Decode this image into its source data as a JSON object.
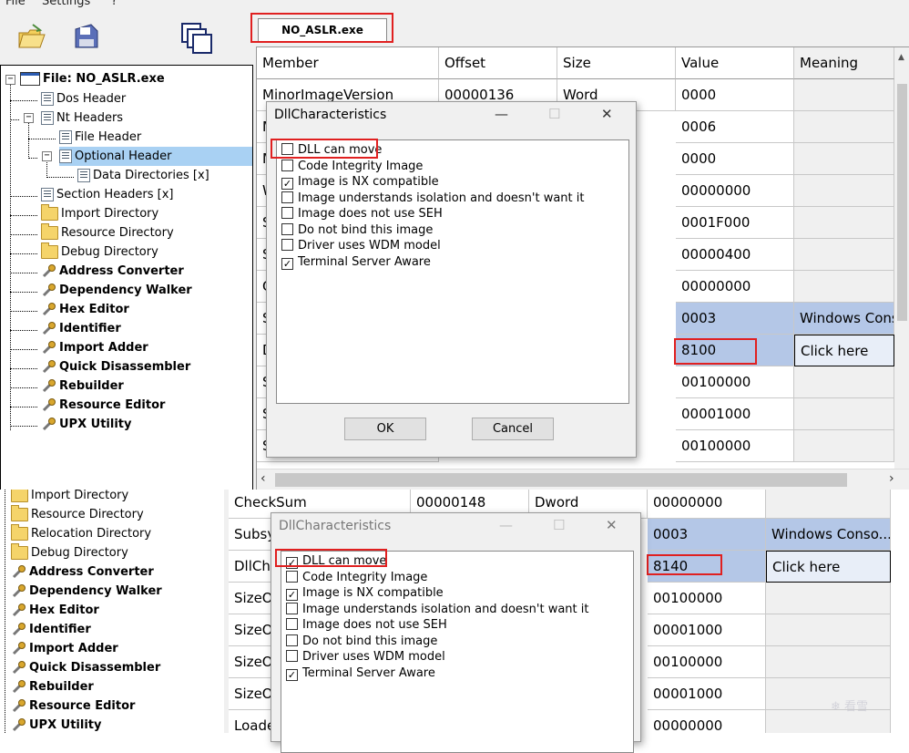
{
  "menu": {
    "file": "File",
    "settings": "Settings",
    "help": "?"
  },
  "tab": {
    "label": "NO_ASLR.exe"
  },
  "tree": {
    "root": "File: NO_ASLR.exe",
    "items": [
      "Dos Header",
      "Nt Headers",
      "File Header",
      "Optional Header",
      "Data Directories [x]",
      "Section Headers [x]",
      "Import Directory",
      "Resource Directory",
      "Debug Directory",
      "Address Converter",
      "Dependency Walker",
      "Hex Editor",
      "Identifier",
      "Import Adder",
      "Quick Disassembler",
      "Rebuilder",
      "Resource Editor",
      "UPX Utility"
    ]
  },
  "grid": {
    "headers": [
      "Member",
      "Offset",
      "Size",
      "Value",
      "Meaning"
    ],
    "rows": [
      {
        "member": "MinorImageVersion",
        "offset": "00000136",
        "size": "Word",
        "value": "0000",
        "meaning": ""
      },
      {
        "member": "M",
        "value": "0006"
      },
      {
        "member": "M",
        "value": "0000"
      },
      {
        "member": "W",
        "value": "00000000"
      },
      {
        "member": "S",
        "value": "0001F000"
      },
      {
        "member": "S",
        "value": "00000400"
      },
      {
        "member": "C",
        "value": "00000000"
      },
      {
        "member": "S",
        "value": "0003",
        "meaning": "Windows Conso"
      },
      {
        "member": "D",
        "value": "8100",
        "meaning": "Click here"
      },
      {
        "member": "S",
        "value": "00100000"
      },
      {
        "member": "S",
        "value": "00001000"
      },
      {
        "member": "S",
        "value": "00100000"
      }
    ]
  },
  "dialog1": {
    "title": "DllCharacteristics",
    "items": [
      {
        "label": "DLL can move",
        "checked": false
      },
      {
        "label": "Code Integrity Image",
        "checked": false
      },
      {
        "label": "Image is NX compatible",
        "checked": true
      },
      {
        "label": "Image understands isolation and doesn't want it",
        "checked": false
      },
      {
        "label": "Image does not use SEH",
        "checked": false
      },
      {
        "label": "Do not bind this image",
        "checked": false
      },
      {
        "label": "Driver uses WDM model",
        "checked": false
      },
      {
        "label": "Terminal Server Aware",
        "checked": true
      }
    ],
    "ok": "OK",
    "cancel": "Cancel"
  },
  "tree2": {
    "items": [
      "Import Directory",
      "Resource Directory",
      "Relocation Directory",
      "Debug Directory",
      "Address Converter",
      "Dependency Walker",
      "Hex Editor",
      "Identifier",
      "Import Adder",
      "Quick Disassembler",
      "Rebuilder",
      "Resource Editor",
      "UPX Utility"
    ]
  },
  "grid2": {
    "rows": [
      {
        "member": "CheckSum",
        "offset": "00000148",
        "size": "Dword",
        "value": "00000000",
        "meaning": ""
      },
      {
        "member": "Subsy",
        "value": "0003",
        "meaning": "Windows Conso..."
      },
      {
        "member": "DllCha",
        "value": "8140",
        "meaning": "Click here"
      },
      {
        "member": "SizeO",
        "value": "00100000"
      },
      {
        "member": "SizeO",
        "value": "00001000"
      },
      {
        "member": "SizeO",
        "value": "00100000"
      },
      {
        "member": "SizeO",
        "value": "00001000"
      },
      {
        "member": "Loade",
        "value": "00000000"
      }
    ]
  },
  "dialog2": {
    "title": "DllCharacteristics",
    "items": [
      {
        "label": "DLL can move",
        "checked": true
      },
      {
        "label": "Code Integrity Image",
        "checked": false
      },
      {
        "label": "Image is NX compatible",
        "checked": true
      },
      {
        "label": "Image understands isolation and doesn't want it",
        "checked": false
      },
      {
        "label": "Image does not use SEH",
        "checked": false
      },
      {
        "label": "Do not bind this image",
        "checked": false
      },
      {
        "label": "Driver uses WDM model",
        "checked": false
      },
      {
        "label": "Terminal Server Aware",
        "checked": true
      }
    ]
  },
  "watermark": "看雪",
  "icons": {
    "open": "open-file-icon",
    "save": "save-disk-icon",
    "windows": "cascade-windows-icon",
    "tool": "tool-wrench-icon",
    "folder": "folder-icon",
    "doc": "document-icon"
  },
  "colors": {
    "highlight": "#e02020",
    "selection": "#b4c7e7",
    "tree_selection": "#a9d1f3"
  }
}
